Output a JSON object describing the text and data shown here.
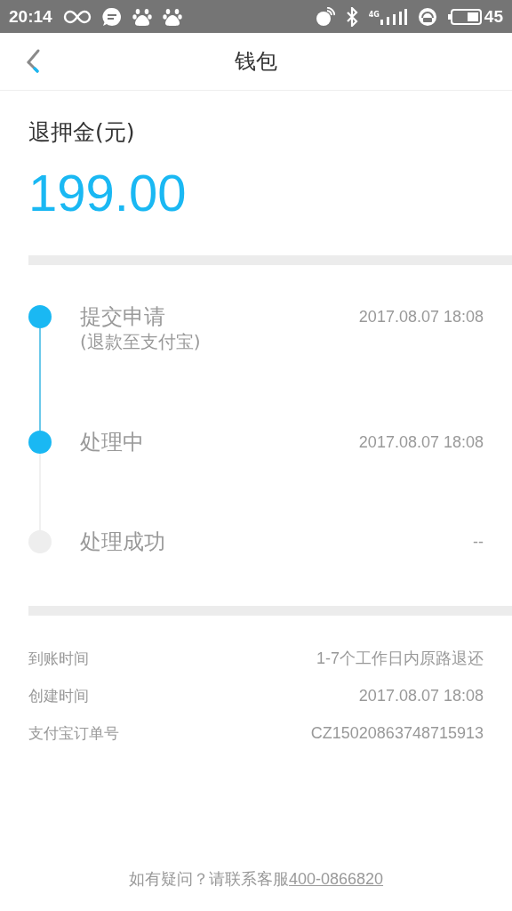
{
  "status_bar": {
    "time": "20:14",
    "network": "4G",
    "battery": "45"
  },
  "nav": {
    "title": "钱包"
  },
  "refund": {
    "label": "退押金(元)",
    "amount": "199.00"
  },
  "steps": [
    {
      "title": "提交申请",
      "note": "(退款至支付宝)",
      "time": "2017.08.07 18:08",
      "done": true
    },
    {
      "title": "处理中",
      "time": "2017.08.07 18:08",
      "done": true
    },
    {
      "title": "处理成功",
      "time": "--",
      "done": false
    }
  ],
  "details": [
    {
      "label": "到账时间",
      "value": "1-7个工作日内原路退还"
    },
    {
      "label": "创建时间",
      "value": "2017.08.07 18:08"
    },
    {
      "label": "支付宝订单号",
      "value": "CZ15020863748715913"
    }
  ],
  "footer": {
    "text": "如有疑问？请联系客服",
    "phone": "400-0866820"
  }
}
